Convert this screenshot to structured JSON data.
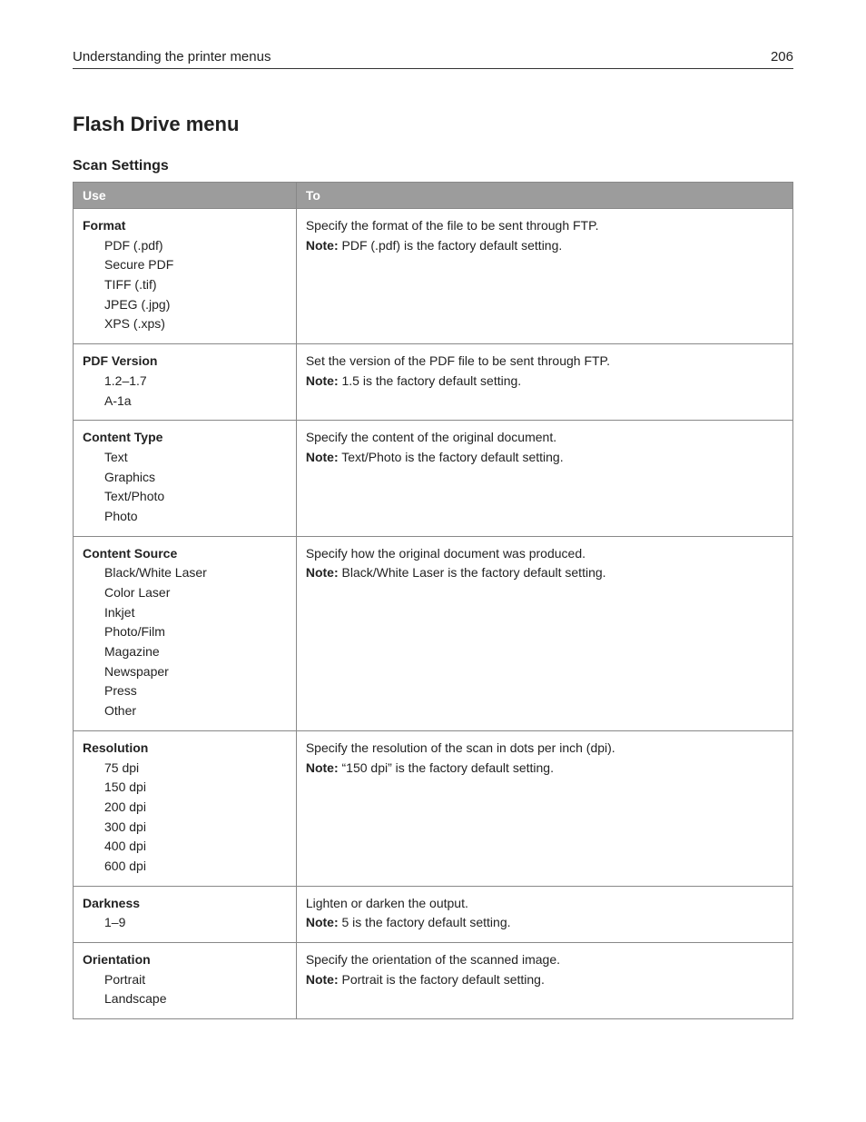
{
  "header": {
    "title": "Understanding the printer menus",
    "page": "206"
  },
  "h2": "Flash Drive menu",
  "h3": "Scan Settings",
  "columns": {
    "use": "Use",
    "to": "To"
  },
  "note_label": "Note:",
  "rows": [
    {
      "name": "Format",
      "options": [
        "PDF (.pdf)",
        "Secure PDF",
        "TIFF (.tif)",
        "JPEG (.jpg)",
        "XPS (.xps)"
      ],
      "desc": "Specify the format of the file to be sent through FTP.",
      "note": " PDF (.pdf) is the factory default setting."
    },
    {
      "name": "PDF Version",
      "options": [
        "1.2–1.7",
        "A‑1a"
      ],
      "desc": "Set the version of the PDF file to be sent through FTP.",
      "note": " 1.5 is the factory default setting."
    },
    {
      "name": "Content Type",
      "options": [
        "Text",
        "Graphics",
        "Text/Photo",
        "Photo"
      ],
      "desc": "Specify the content of the original document.",
      "note": " Text/Photo is the factory default setting."
    },
    {
      "name": "Content Source",
      "options": [
        "Black/White Laser",
        "Color Laser",
        "Inkjet",
        "Photo/Film",
        "Magazine",
        "Newspaper",
        "Press",
        "Other"
      ],
      "desc": "Specify how the original document was produced.",
      "note": " Black/White Laser is the factory default setting."
    },
    {
      "name": "Resolution",
      "options": [
        "75 dpi",
        "150 dpi",
        "200 dpi",
        "300 dpi",
        "400 dpi",
        "600 dpi"
      ],
      "desc": "Specify the resolution of the scan in dots per inch (dpi).",
      "note": " “150 dpi” is the factory default setting."
    },
    {
      "name": "Darkness",
      "options": [
        "1–9"
      ],
      "desc": "Lighten or darken the output.",
      "note": " 5 is the factory default setting."
    },
    {
      "name": "Orientation",
      "options": [
        "Portrait",
        "Landscape"
      ],
      "desc": "Specify the orientation of the scanned image.",
      "note": " Portrait is the factory default setting."
    }
  ]
}
